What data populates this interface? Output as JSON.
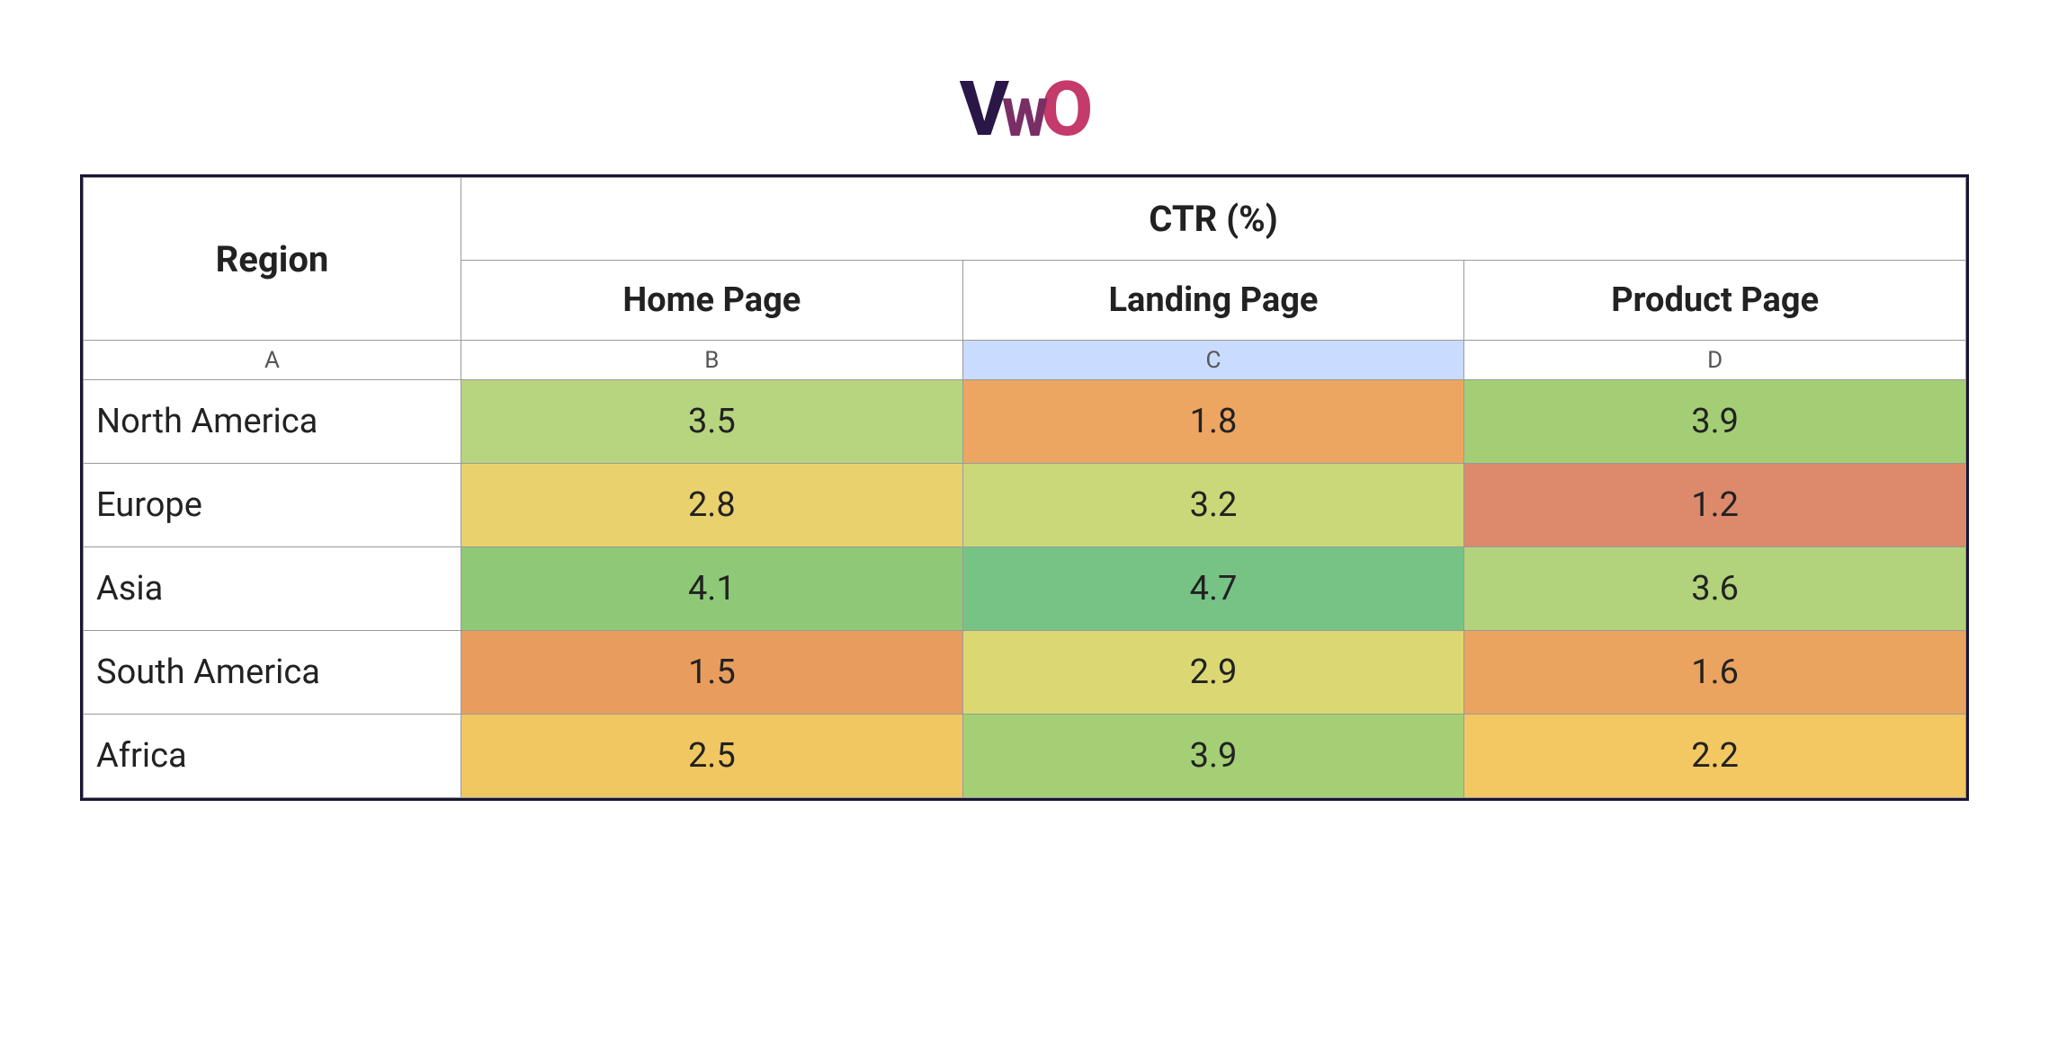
{
  "logo": {
    "v": "V",
    "w": "W",
    "o": "O"
  },
  "column_letters": [
    "A",
    "B",
    "C",
    "D"
  ],
  "selected_column_index": 2,
  "headers": {
    "region": "Region",
    "metric": "CTR (%)",
    "sub": [
      "Home Page",
      "Landing Page",
      "Product Page"
    ]
  },
  "rows": [
    {
      "region": "North America",
      "values": [
        3.5,
        1.8,
        3.9
      ]
    },
    {
      "region": "Europe",
      "values": [
        2.8,
        3.2,
        1.2
      ]
    },
    {
      "region": "Asia",
      "values": [
        4.1,
        4.7,
        3.6
      ]
    },
    {
      "region": "South America",
      "values": [
        1.5,
        2.9,
        1.6
      ]
    },
    {
      "region": "Africa",
      "values": [
        2.5,
        3.9,
        2.2
      ]
    }
  ],
  "cell_colors": [
    [
      "#b7d47f",
      "#eda661",
      "#a3ce75"
    ],
    [
      "#e9d16e",
      "#cad879",
      "#dc8a6b"
    ],
    [
      "#8ec977",
      "#76c385",
      "#b2d27c"
    ],
    [
      "#e89d5e",
      "#dbd873",
      "#eaa45f"
    ],
    [
      "#f1c762",
      "#a4cf75",
      "#f3c863"
    ]
  ],
  "chart_data": {
    "type": "heatmap",
    "title": "CTR (%)",
    "row_labels": [
      "North America",
      "Europe",
      "Asia",
      "South America",
      "Africa"
    ],
    "col_labels": [
      "Home Page",
      "Landing Page",
      "Product Page"
    ],
    "values": [
      [
        3.5,
        1.8,
        3.9
      ],
      [
        2.8,
        3.2,
        1.2
      ],
      [
        4.1,
        4.7,
        3.6
      ],
      [
        1.5,
        2.9,
        1.6
      ],
      [
        2.5,
        3.9,
        2.2
      ]
    ],
    "value_range": [
      1.2,
      4.7
    ],
    "color_scale": "red-yellow-green"
  }
}
